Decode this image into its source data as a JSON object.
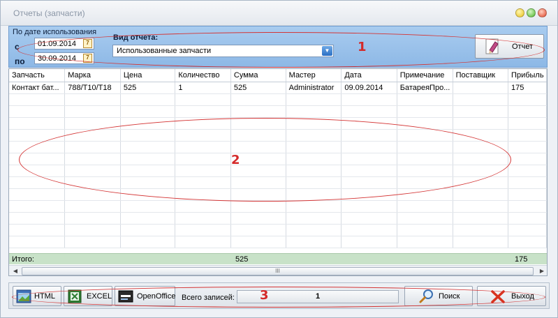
{
  "window": {
    "title": "Отчеты (запчасти)"
  },
  "filter": {
    "by_date_label": "По дате использования",
    "from_label": "с",
    "to_label": "по",
    "from_date": "01.09.2014",
    "to_date": "30.09.2014",
    "report_type_label": "Вид отчета:",
    "report_type_value": "Использованные запчасти",
    "report_button": "Отчет"
  },
  "grid": {
    "columns": [
      "Запчасть",
      "Марка",
      "Цена",
      "Количество",
      "Сумма",
      "Мастер",
      "Дата",
      "Примечание",
      "Поставщик",
      "Прибыль"
    ],
    "rows": [
      [
        "Контакт бат...",
        "788/T10/T18",
        "525",
        "1",
        "525",
        "Administrator",
        "09.09.2014",
        "БатареяПро...",
        "",
        "175"
      ]
    ],
    "totals_label": "Итого:",
    "totals_sum": "525",
    "totals_profit": "175",
    "scroll_thumb": "III"
  },
  "bottom": {
    "html_button": "HTML",
    "excel_button": "EXCEL",
    "openoffice_button": "OpenOffice",
    "records_label": "Всего записей:",
    "records_count": "1",
    "search_button": "Поиск",
    "exit_button": "Выход"
  },
  "annotations": [
    "1",
    "2",
    "3"
  ],
  "colors": {
    "filter_panel": "#8db8e6",
    "totals_row": "#c8e2c8",
    "annotation": "#d43535"
  }
}
